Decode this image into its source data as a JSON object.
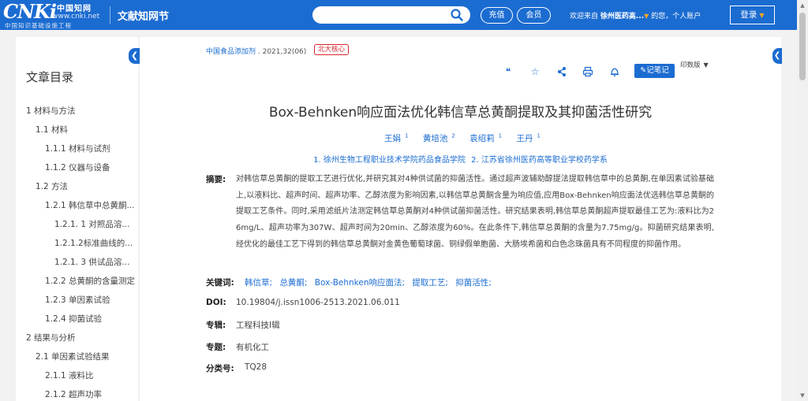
{
  "header": {
    "logo_text": "CNKi",
    "logo_cn": "中国知网",
    "logo_url": "www.cnki.net",
    "logo_sub": "中国知识基础设施工程",
    "section_name": "文献知网节",
    "search_placeholder": "",
    "recharge_label": "充值",
    "member_label": "会员",
    "welcome_prefix": "欢迎来自",
    "institution": "徐州医药高...",
    "welcome_suffix": "的您，个人账户",
    "login_label": "登录"
  },
  "sidebar": {
    "title": "文章目录",
    "items": [
      {
        "label": "1 材料与方法"
      },
      {
        "label": "1.1 材料"
      },
      {
        "label": "1.1.1 材料与试剂"
      },
      {
        "label": "1.1.2 仪器与设备"
      },
      {
        "label": "1.2 方法"
      },
      {
        "label": "1.2.1 韩信草中总黄酮..."
      },
      {
        "label": "1.2.1. 1 对照品溶..."
      },
      {
        "label": "1.2.1.2标准曲线的..."
      },
      {
        "label": "1.2.1. 3 供试品溶..."
      },
      {
        "label": "1.2.2 总黄酮的含量测定"
      },
      {
        "label": "1.2.3 单因素试验"
      },
      {
        "label": "1.2.4 抑菌试验"
      },
      {
        "label": "2 结果与分析"
      },
      {
        "label": "2.1 单因素试验结果"
      },
      {
        "label": "2.1.1 液料比"
      },
      {
        "label": "2.1.2 超声功率"
      }
    ]
  },
  "article": {
    "journal": "中国食品添加剂",
    "issue": " . 2021,32(06)",
    "core_badge": "北大核心",
    "note_label": "记笔记",
    "print_label": "印数版",
    "title": "Box-Behnken响应面法优化韩信草总黄酮提取及其抑菌活性研究",
    "authors": [
      {
        "name": "王娟",
        "sup": "1"
      },
      {
        "name": "黄培池",
        "sup": "2"
      },
      {
        "name": "袁绍莉",
        "sup": "1"
      },
      {
        "name": "王丹",
        "sup": "1"
      }
    ],
    "affiliations": [
      "1. 徐州生物工程职业技术学院药品食品学院",
      "2. 江苏省徐州医药高等职业学校药学系"
    ],
    "abstract_label": "摘要:",
    "abstract": "对韩信草总黄酮的提取工艺进行优化,并研究其对4种供试菌的抑菌活性。通过超声波辅助醇提法提取韩信草中的总黄酮,在单因素试验基础上,以液料比、超声时间、超声功率、乙醇浓度为影响因素,以韩信草总黄酮含量为响应值,应用Box-Behnken响应面法优选韩信草总黄酮的提取工艺条件。同时,采用滤纸片法测定韩信草总黄酮对4种供试菌抑菌活性。研究结果表明,韩信草总黄酮超声提取最佳工艺为:液料比为26mg/L、超声功率为307W、超声时间为20min、乙醇浓度为60%。在此条件下,韩信草总黄酮的含量为7.75mg/g。抑菌研究结果表明,经优化的最佳工艺下得到的韩信草总黄酮对金黄色葡萄球菌、铜绿假单胞菌、大肠埃希菌和白色念珠菌具有不同程度的抑菌作用。",
    "keywords_label": "关键词:",
    "keywords": [
      "韩信草;",
      "总黄酮;",
      "Box-Behnken响应面法;",
      "提取工艺;",
      "抑菌活性;"
    ],
    "doi_label": "DOI:",
    "doi": "10.19804/j.issn1006-2513.2021.06.011",
    "series_label": "专辑:",
    "series": "工程科技Ⅰ辑",
    "subject_label": "专题:",
    "subject": "有机化工",
    "class_label": "分类号:",
    "class_no": "TQ28"
  },
  "colors": {
    "brand": "#1b6cd1",
    "badge": "#d9252b"
  }
}
